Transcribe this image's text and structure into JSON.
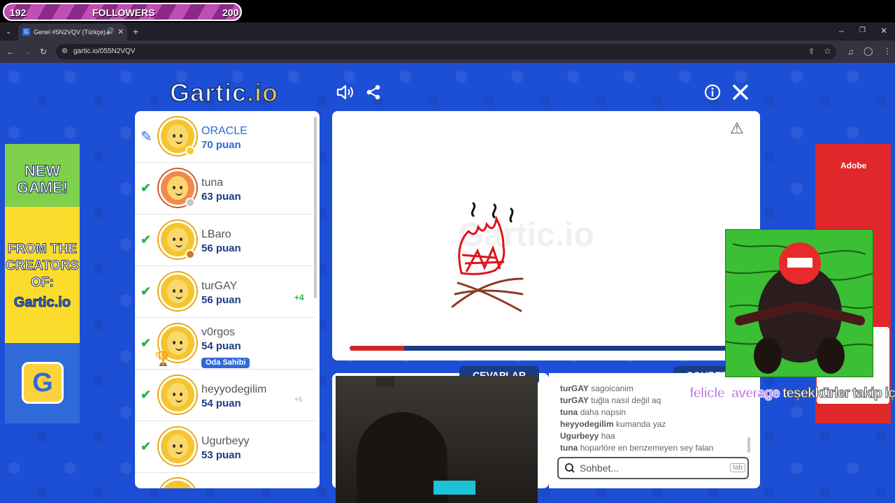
{
  "stream": {
    "followers_current": "192",
    "followers_label": "FOLLOWERS",
    "followers_goal": "200",
    "followers_progress": 0.96,
    "alert_user": "felicle_average",
    "alert_message": "teşekkürler takip için"
  },
  "browser": {
    "tab_title": "Genel #5N2VQV (Türkçe) -",
    "url": "gartic.io/055N2VQV"
  },
  "game": {
    "logo_main": "Gartic",
    "logo_suffix": ".io",
    "timer_progress": 0.14,
    "colors": {
      "background": "#1d4fd6",
      "navy": "#1a3c86",
      "accent_blue": "#2f6ad9",
      "check_green": "#2cb34a"
    },
    "players": [
      {
        "name": "ORACLE",
        "score": "70 puan",
        "status": "drawing",
        "dot": "#f8cc2d"
      },
      {
        "name": "tuna",
        "score": "63 puan",
        "status": "guessed",
        "dot": "#c7c7c7"
      },
      {
        "name": "LBaro",
        "score": "56 puan",
        "status": "guessed",
        "dot": "#d9761a"
      },
      {
        "name": "turGAY",
        "score": "56 puan",
        "status": "guessed",
        "plus": "+4"
      },
      {
        "name": "v0rgos",
        "score": "54 puan",
        "status": "guessed",
        "badge": "Oda Sahibi"
      },
      {
        "name": "heyyodegilim",
        "score": "54 puan",
        "status": "guessed",
        "plus": "+5"
      },
      {
        "name": "Ugurbeyy",
        "score": "53 puan",
        "status": "guessed"
      }
    ],
    "answers_tab": "CEVAPLAR",
    "chat_tab": "SOHBET",
    "chat_placeholder": "Sohbet...",
    "tab_key_hint": "tab",
    "chat": [
      {
        "user": "turGAY",
        "text": "sagoicanim"
      },
      {
        "user": "turGAY",
        "text": "tuğla nasıl değil aq"
      },
      {
        "user": "tuna",
        "text": "daha napsin"
      },
      {
        "user": "heyyodegilim",
        "text": "kumanda yaz"
      },
      {
        "user": "Ugurbeyy",
        "text": "haa"
      },
      {
        "user": "tuna",
        "text": "hoparlöre en benzemeyen sey falan"
      }
    ]
  },
  "ads": {
    "left_lines": [
      "NEW",
      "GAME!",
      "FROM THE",
      "CREATORS",
      "OF:",
      "Gartic.io"
    ],
    "right_brand": "Adobe"
  },
  "icons": [
    "chevron-down-icon",
    "gartic-favicon",
    "speaker-icon",
    "close-icon",
    "plus-icon",
    "back-arrow-icon",
    "forward-arrow-icon",
    "reload-icon",
    "site-info-icon",
    "install-icon",
    "star-icon",
    "media-icon",
    "profile-icon",
    "menu-icon",
    "volume-icon",
    "share-icon",
    "info-icon",
    "pencil-icon",
    "check-icon",
    "trophy-icon",
    "report-warning-icon",
    "search-icon"
  ]
}
